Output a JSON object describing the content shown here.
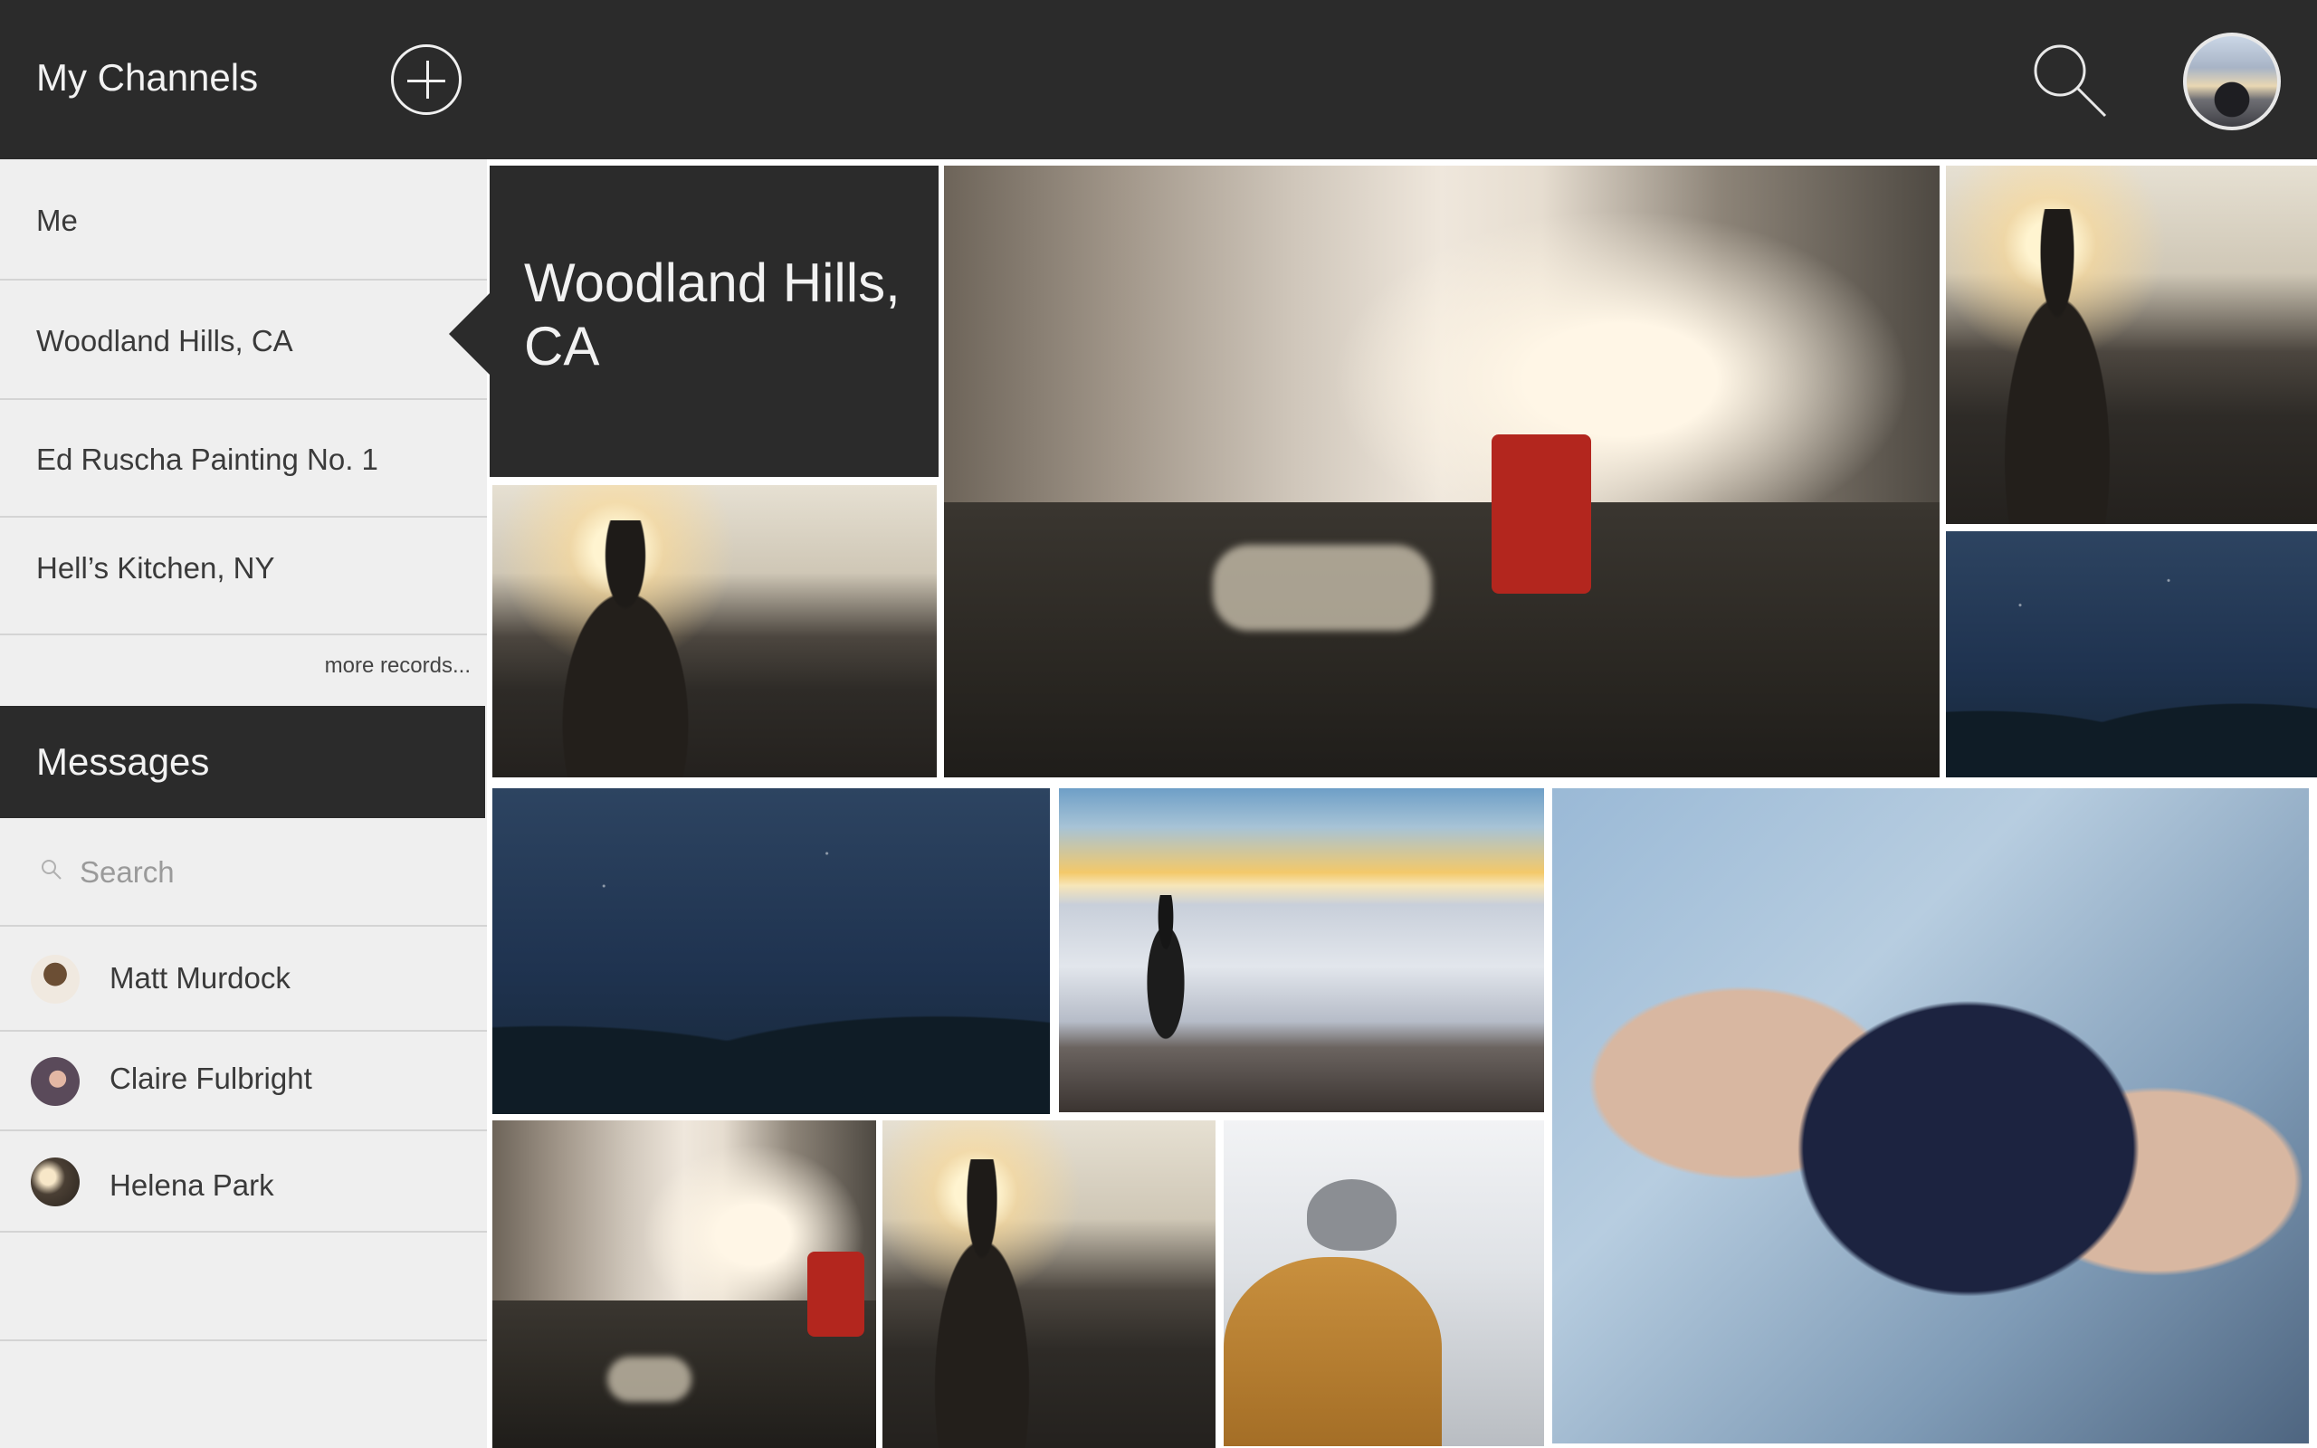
{
  "header": {
    "title": "My Channels",
    "add_icon": "plus-circle-icon",
    "search_icon": "search-icon",
    "avatar": "user-avatar"
  },
  "channels": {
    "items": [
      {
        "label": "Me"
      },
      {
        "label": "Woodland Hills, CA"
      },
      {
        "label": "Ed Ruscha Painting No. 1"
      },
      {
        "label": "Hell’s Kitchen, NY"
      }
    ],
    "more_link": "more records...",
    "selected": "Woodland Hills, CA"
  },
  "messages": {
    "heading": "Messages",
    "search_placeholder": "Search",
    "contacts": [
      {
        "name": "Matt Murdock"
      },
      {
        "name": "Claire Fulbright"
      },
      {
        "name": "Helena Park"
      }
    ]
  },
  "gallery": {
    "channel_title": "Woodland Hills, CA",
    "photos": [
      "street-scene",
      "man-silhouette-sunset",
      "night-sky",
      "man-over-clouds",
      "grapes-in-hands",
      "person-in-beanie"
    ]
  },
  "colors": {
    "dark": "#2b2b2b",
    "sidebar": "#efefef",
    "divider": "#d4d4d4"
  }
}
